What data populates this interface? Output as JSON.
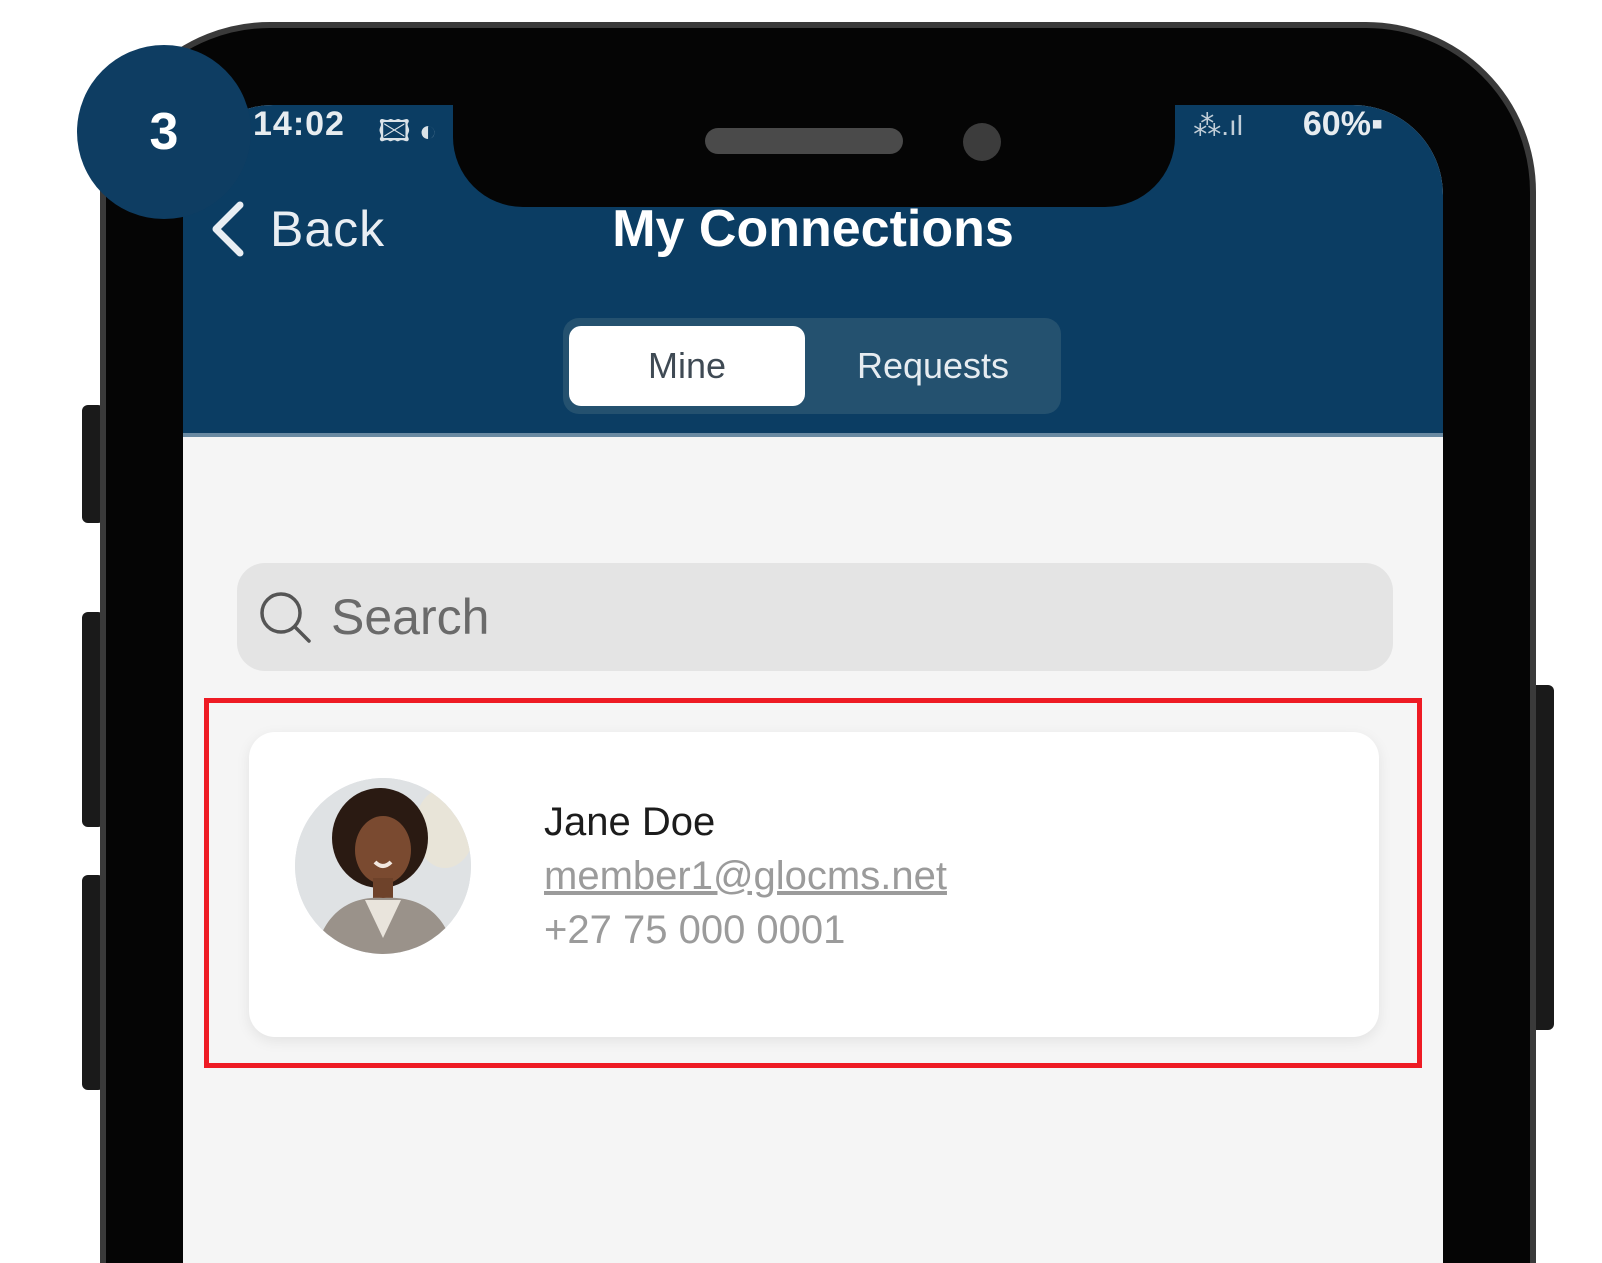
{
  "step_badge": "3",
  "status_bar": {
    "time": "14:02",
    "left_icons": "🖾 ◐",
    "signal": "⁂.ıl",
    "battery": "60%▪"
  },
  "nav": {
    "back_label": "Back",
    "title": "My Connections"
  },
  "tabs": [
    {
      "label": "Mine",
      "selected": true
    },
    {
      "label": "Requests",
      "selected": false
    }
  ],
  "search": {
    "placeholder": "Search",
    "value": ""
  },
  "contacts": [
    {
      "name": "Jane Doe",
      "email": "member1@glocms.net",
      "phone": "+27 75 000 0001"
    }
  ],
  "colors": {
    "header": "#0b3d63",
    "highlight": "#ee1b24",
    "badge": "#0e3d62"
  }
}
